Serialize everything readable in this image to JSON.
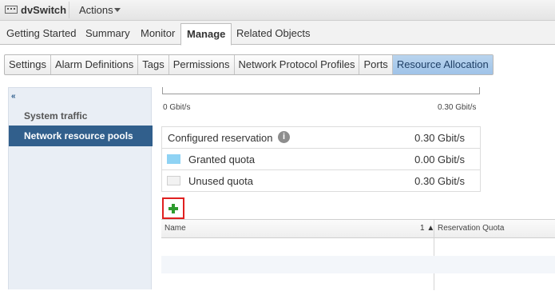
{
  "titlebar": {
    "title": "dvSwitch",
    "actions_label": "Actions",
    "icon": "dvswitch-icon"
  },
  "main_tabs": [
    {
      "label": "Getting Started"
    },
    {
      "label": "Summary"
    },
    {
      "label": "Monitor"
    },
    {
      "label": "Manage",
      "active": true
    },
    {
      "label": "Related Objects"
    }
  ],
  "sub_tabs": [
    {
      "label": "Settings"
    },
    {
      "label": "Alarm Definitions"
    },
    {
      "label": "Tags"
    },
    {
      "label": "Permissions"
    },
    {
      "label": "Network Protocol Profiles"
    },
    {
      "label": "Ports"
    },
    {
      "label": "Resource Allocation",
      "active": true
    }
  ],
  "sidebar": {
    "collapse_icon": "«",
    "items": [
      {
        "label": "System traffic"
      },
      {
        "label": "Network resource pools",
        "selected": true
      }
    ]
  },
  "bandwidth_scale": {
    "min_label": "0 Gbit/s",
    "max_label": "0.30 Gbit/s"
  },
  "quota": {
    "configured_reservation": {
      "label": "Configured reservation",
      "value": "0.30 Gbit/s"
    },
    "granted_quota": {
      "label": "Granted quota",
      "value": "0.00 Gbit/s",
      "color": "#8fd3f4"
    },
    "unused_quota": {
      "label": "Unused quota",
      "value": "0.30 Gbit/s",
      "color": "#f2f2f2"
    }
  },
  "pools_grid": {
    "add_button_icon": "add-plus-icon",
    "columns": [
      {
        "label": "Name",
        "sort_indicator": "1 ▲"
      },
      {
        "label": "Reservation Quota"
      }
    ],
    "rows": []
  },
  "colors": {
    "selected_sidebar": "#315f8c",
    "active_subtab": "#a8cbec",
    "add_highlight": "#e02020",
    "add_plus": "#2e9b2e"
  }
}
